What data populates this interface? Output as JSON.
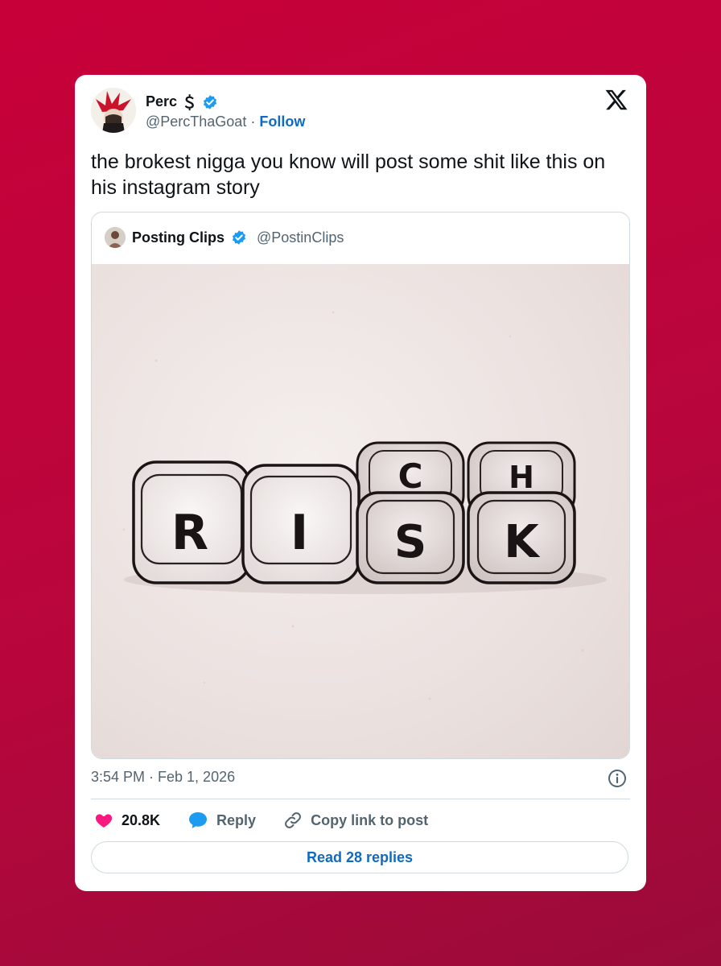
{
  "tweet": {
    "author_name": "Perc",
    "author_handle": "@PercThaGoat",
    "separator": "·",
    "follow_label": "Follow",
    "text": "the brokest nigga you know will post some shit like this on his instagram story",
    "timestamp": "3:54 PM · Feb 1, 2026",
    "likes": "20.8K",
    "reply_label": "Reply",
    "copy_link_label": "Copy link to post",
    "read_replies_label": "Read 28 replies"
  },
  "quoted": {
    "name": "Posting Clips",
    "handle": "@PostinClips",
    "image": {
      "dice_letters": [
        "R",
        "I",
        "S",
        "K"
      ],
      "top_dice_letters": [
        "C",
        "H"
      ]
    }
  },
  "colors": {
    "background_top": "#c8003a",
    "background_bottom": "#9a0b3a",
    "accent_blue": "#0f6bc2",
    "verified_blue": "#1d9bf0",
    "like_pink": "#f91880"
  },
  "icons": {
    "close": "x-logo-icon",
    "verified": "verified-badge-icon",
    "like": "heart-icon",
    "reply": "speech-bubble-icon",
    "copy": "link-icon",
    "info": "info-icon"
  }
}
